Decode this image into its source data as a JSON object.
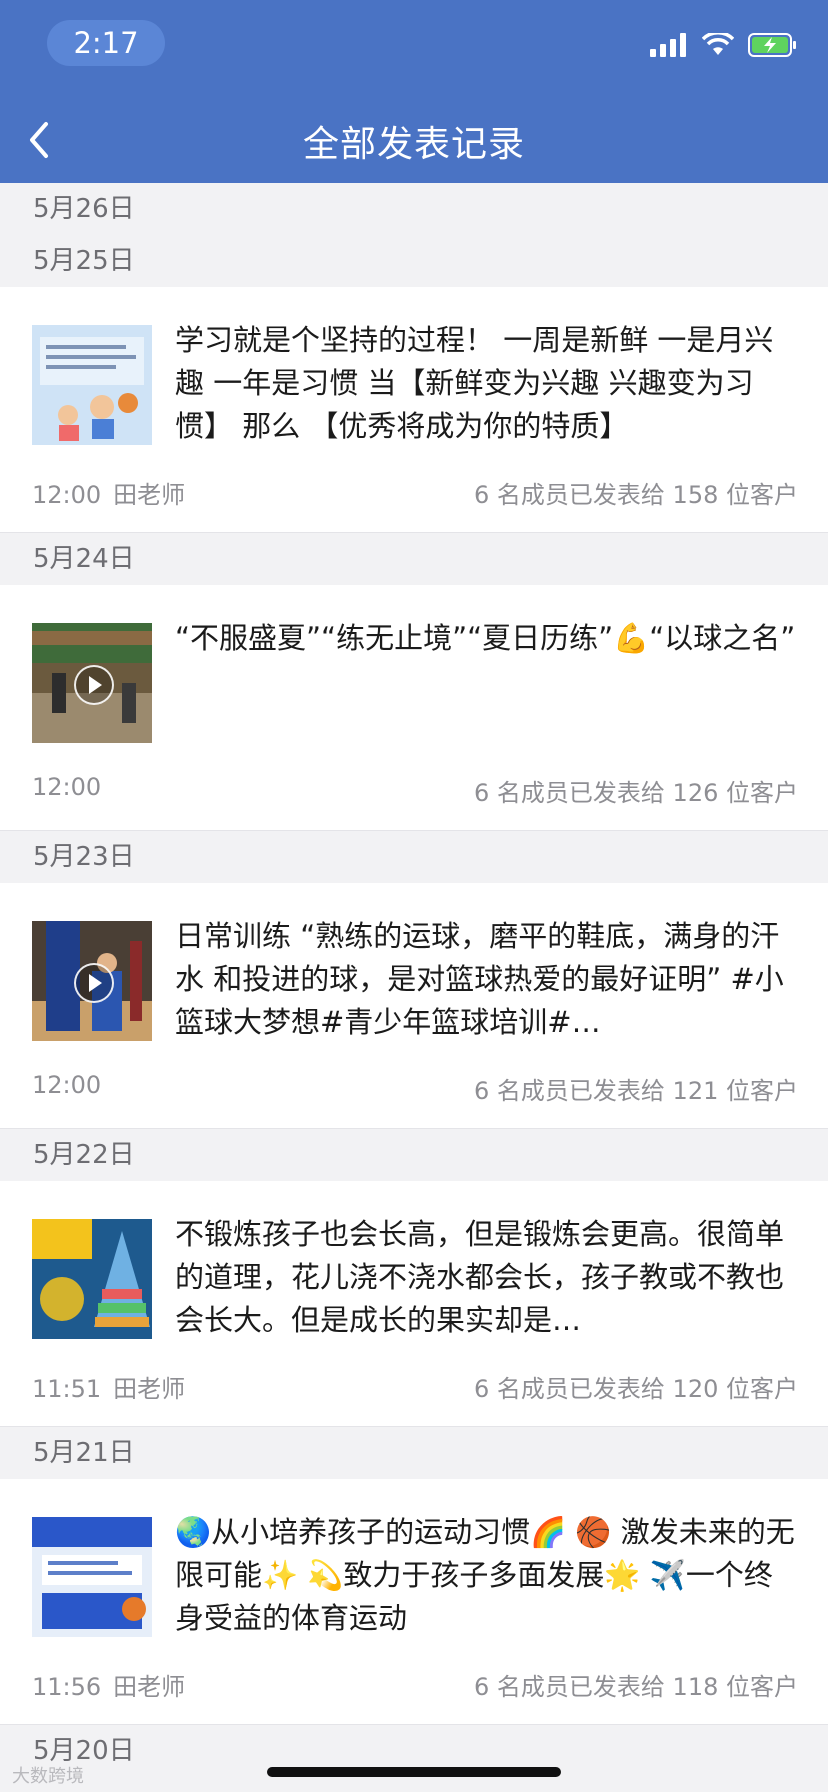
{
  "status_bar": {
    "time": "2:17"
  },
  "nav": {
    "title": "全部发表记录"
  },
  "sections": [
    {
      "date": "5月26日"
    },
    {
      "date": "5月25日",
      "post": {
        "thumb": "poster",
        "text": "学习就是个坚持的过程！ 一周是新鲜 一是月兴趣 一年是习惯 当【新鲜变为兴趣 兴趣变为习惯】 那么 【优秀将成为你的特质】",
        "time": "12:00",
        "author": "田老师",
        "stats": "6 名成员已发表给 158 位客户"
      }
    },
    {
      "date": "5月24日",
      "post": {
        "thumb": "video",
        "text": "“不服盛夏”“练无止境”“夏日历练”💪“以球之名”",
        "time": "12:00",
        "author": "",
        "stats": "6 名成员已发表给 126 位客户"
      }
    },
    {
      "date": "5月23日",
      "post": {
        "thumb": "video",
        "text": "日常训练 “熟练的运球，磨平的鞋底，满身的汗水 和投进的球，是对篮球热爱的最好证明” #小篮球大梦想#青少年篮球培训#…",
        "time": "12:00",
        "author": "",
        "stats": "6 名成员已发表给 121 位客户"
      }
    },
    {
      "date": "5月22日",
      "post": {
        "thumb": "pyramid",
        "text": "不锻炼孩子也会长高，但是锻炼会更高。很简单的道理，花儿浇不浇水都会长，孩子教或不教也会长大。但是成长的果实却是…",
        "time": "11:51",
        "author": "田老师",
        "stats": "6 名成员已发表给 120 位客户"
      }
    },
    {
      "date": "5月21日",
      "post": {
        "thumb": "flyer",
        "text": "🌏从小培养孩子的运动习惯🌈 🏀 激发未来的无限可能✨ 💫致力于孩子多面发展🌟 ✈️一个终身受益的体育运动",
        "time": "11:56",
        "author": "田老师",
        "stats": "6 名成员已发表给 118 位客户"
      }
    },
    {
      "date": "5月20日"
    }
  ],
  "watermark": "大数跨境",
  "colors": {
    "header": "#4a73c4",
    "background": "#f2f2f4",
    "meta_text": "#8e8e93"
  }
}
